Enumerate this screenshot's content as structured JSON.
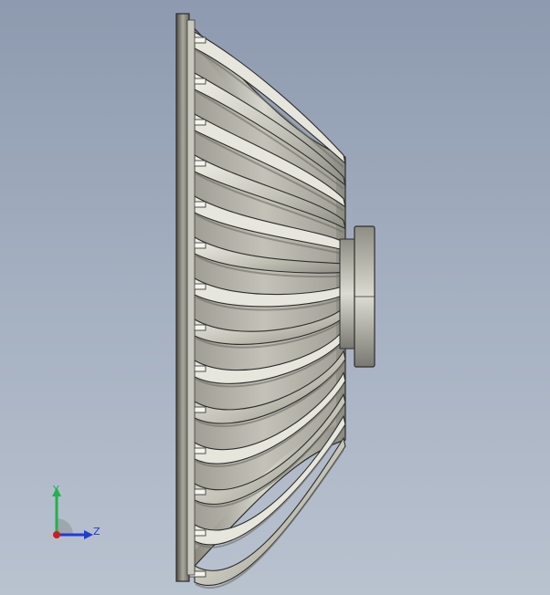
{
  "viewport": {
    "background_top": "#8d9aaf",
    "background_bottom": "#b9c2cf"
  },
  "model": {
    "part": "compressor-impeller",
    "view": "side",
    "blade_count": 14,
    "colors": {
      "metal_light": "#e7e6dd",
      "metal_mid": "#b7b6ab",
      "metal_dark": "#6f6e66",
      "edge": "#2d2d2a"
    }
  },
  "triad": {
    "y_label": "Y",
    "z_label": "Z",
    "y_color": "#22b14c",
    "z_color": "#1f3bd8",
    "x_color": "#d21c1c"
  }
}
